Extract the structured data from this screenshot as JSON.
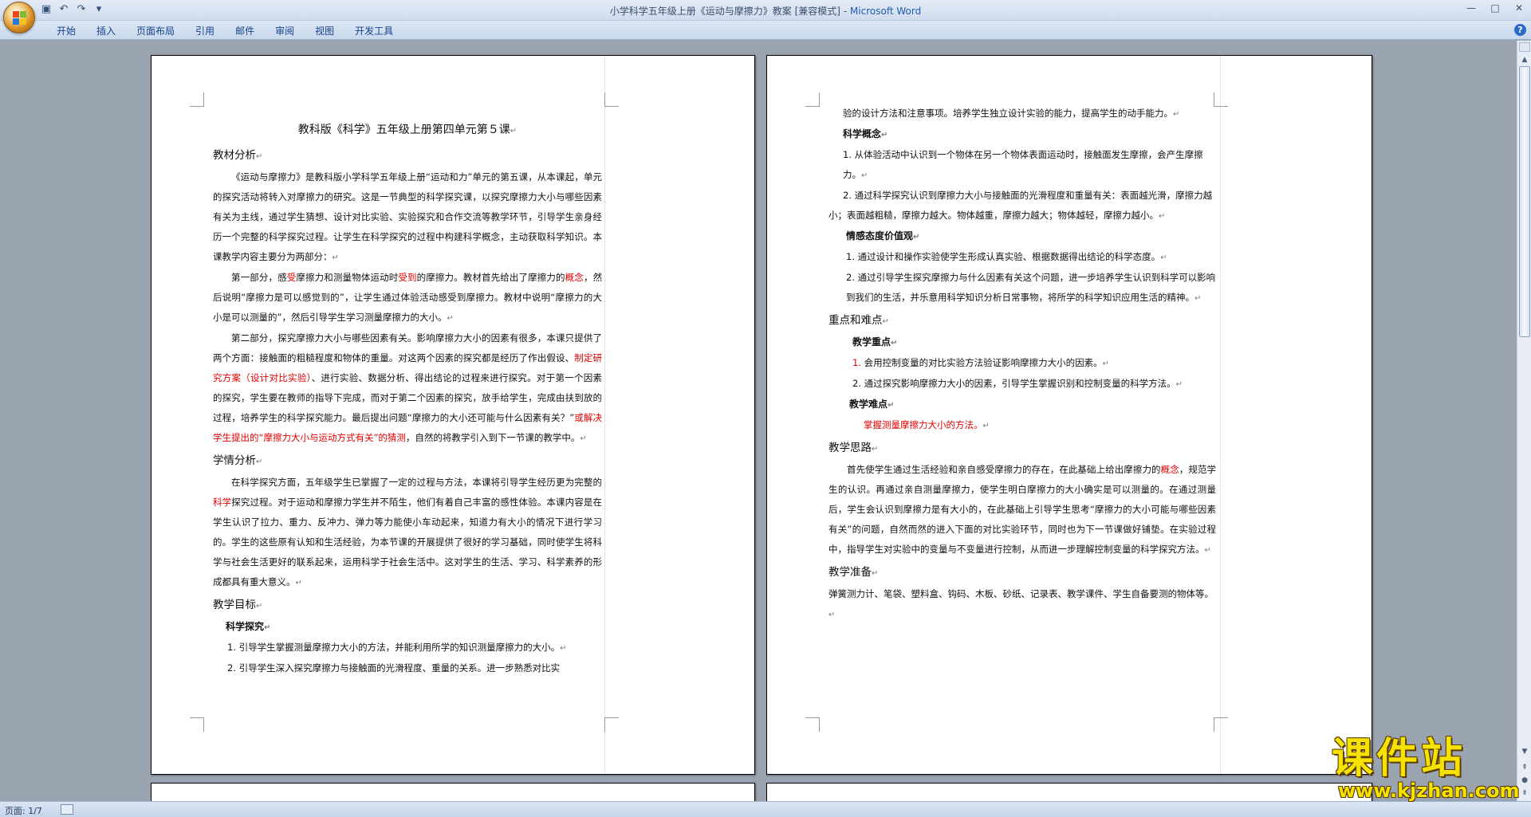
{
  "window": {
    "title": "小学科学五年级上册《运动与摩擦力》教案 [兼容模式] - ",
    "app_name": "Microsoft Word",
    "controls": [
      "—",
      "□",
      "✕"
    ]
  },
  "qat": {
    "icons": [
      "save-icon",
      "undo-icon",
      "redo-icon",
      "customize-icon"
    ]
  },
  "ribbon": {
    "tabs": [
      "开始",
      "插入",
      "页面布局",
      "引用",
      "邮件",
      "审阅",
      "视图",
      "开发工具"
    ],
    "help": "?"
  },
  "page1": {
    "title": "教科版《科学》五年级上册第四单元第５课",
    "s1_heading": "教材分析",
    "p1": "《运动与摩擦力》是教科版小学科学五年级上册“运动和力”单元的第五课，从本课起，单元的探究活动将转入对摩擦力的研究。这是一节典型的科学探究课，以探究摩擦力大小与哪些因素有关为主线，通过学生猜想、设计对比实验、实验探究和合作交流等教学环节，引导学生亲身经历一个完整的科学探究过程。让学生在科学探究的过程中构建科学概念，主动获取科学知识。本课教学内容主要分为两部分：",
    "p2_a": "第一部分，感",
    "p2_r1": "受",
    "p2_b": "摩擦力和测量物体运动时",
    "p2_r2": "受到",
    "p2_c": "的摩擦力。教材首先给出了摩擦力的",
    "p2_r3": "概念",
    "p2_d": "，然后说明“摩擦力是可以感觉到的”，让学生通过体验活动感受到摩擦力。教材中说明“摩擦力的大小是可以测量的”，然后引导学生学习测量摩擦力的大小。",
    "p3_a": "第二部分，探究摩擦力大小与哪些因素有关。影响摩擦力大小的因素有很多，本课只提供了两个方面：接触面的粗糙程度和物体的重量。对这两个因素的探究都是经历了作出假设、",
    "p3_r1": "制定研究方案（设计对比实验）",
    "p3_b": "、进行实验、数据分析、得出结论的过程来进行探究。对于第一个因素的探究，学生要在教师的指导下完成，而对于第二个因素的探究，放手给学生，完成由扶到放的过程，培养学生的科学探究能力。最后提出问题“摩擦力的大小还可能与什么因素有关？”",
    "p3_r2": "或解决学生提出的“摩擦力大小与运动方式有关”的猜测",
    "p3_c": "，自然的将教学引入到下一节课的教学中。",
    "s2_heading": "学情分析",
    "p4_a": "在科学探究方面，五年级学生已掌握了一定的过程与方法，本课将引导学生经历更为完整的",
    "p4_r1": "科学",
    "p4_b": "探究过程。对于运动和摩擦力学生并不陌生，他们有着自己丰富的感性体验。本课内容是在学生认识了拉力、重力、反冲力、弹力等力能使小车动起来，知道力有大小的情况下进行学习的。学生的这些原有认知和生活经验，为本节课的开展提供了很好的学习基础，同时使学生将科学与社会生活更好的联系起来，运用科学于社会生活中。这对学生的生活、学习、科学素养的形成都具有重大意义。",
    "s3_heading": "教学目标",
    "s3_sub": "科学探究",
    "g1": "1. 引导学生掌握测量摩擦力大小的方法，并能利用所学的知识测量摩擦力的大小。",
    "g2": "2. 引导学生深入探究摩擦力与接触面的光滑程度、重量的关系。进一步熟悉对比实"
  },
  "page2": {
    "cont": "验的设计方法和注意事项。培养学生独立设计实验的能力，提高学生的动手能力。",
    "sub1": "科学概念",
    "c1": "1. 从体验活动中认识到一个物体在另一个物体表面运动时，接触面发生摩擦，会产生摩擦力。",
    "c2": "2. 通过科学探究认识到摩擦力大小与接触面的光滑程度和重量有关：表面越光滑，摩擦力越小；表面越粗糙，摩擦力越大。物体越重，摩擦力越大；物体越轻，摩擦力越小。",
    "sub2": "情感态度价值观",
    "e1": "1. 通过设计和操作实验使学生形成认真实验、根据数据得出结论的科学态度。",
    "e2": "2. 通过引导学生探究摩擦力与什么因素有关这个问题，进一步培养学生认识到科学可以影响到我们的生活，并乐意用科学知识分析日常事物，将所学的科学知识应用生活的精神。",
    "h2": "重点和难点",
    "sub3": "教学重点",
    "k1_num": "1.",
    "k1": " 会用控制变量的对比实验方法验证影响摩擦力大小的因素。",
    "k2": "2. 通过探究影响摩擦力大小的因素，引导学生掌握识别和控制变量的科学方法。",
    "sub4": "教学难点",
    "d1": "掌握测量摩擦力大小的方法。",
    "h3": "教学思路",
    "t1_a": "首先使学生通过生活经验和亲自感受摩擦力的存在，在此基础上给出摩擦力的",
    "t1_r": "概念",
    "t1_b": "，规范学生的认识。再通过亲自测量摩擦力，使学生明白摩擦力的大小确实是可以测量的。在通过测量后，学生会认识到摩擦力是有大小的，在此基础上引导学生思考“摩擦力的大小可能与哪些因素有关”的问题，自然而然的进入下面的对比实验环节，同时也为下一节课做好铺垫。在实验过程中，指导学生对实验中的变量与不变量进行控制，从而进一步理解控制变量的科学探究方法。",
    "h4": "教学准备",
    "prep": "弹簧测力计、笔袋、塑料盒、钩码、木板、砂纸、记录表、教学课件、学生自备要测的物体等。"
  },
  "para_mark": "↵",
  "status": {
    "page": "页面: 1/7"
  },
  "watermark": {
    "cn": "课件站",
    "url": "www.kjzhan.com"
  }
}
